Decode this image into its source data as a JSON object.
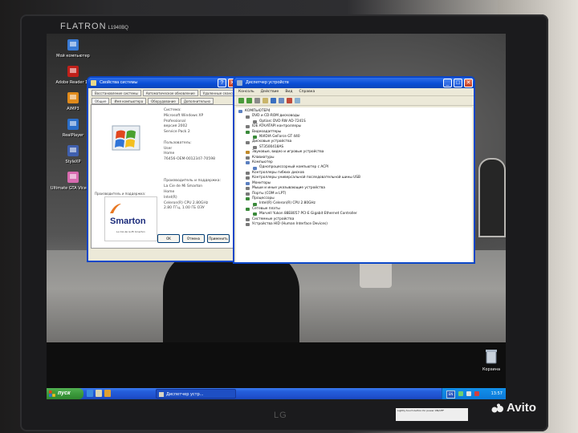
{
  "monitor": {
    "brand": "FLATRON",
    "model": "L1940BQ",
    "maker": "LG",
    "sticker": "Lightly touch button for power ON/OFF"
  },
  "watermark": "Avito",
  "desktop_icons": [
    {
      "label": "Мой компьютер",
      "icon": "computer-icon",
      "color": "#3a7bd5"
    },
    {
      "label": "Adobe Reader 10",
      "icon": "adobe-reader-icon",
      "color": "#c0201a"
    },
    {
      "label": "AIMP3",
      "icon": "aimp-icon",
      "color": "#e08a1a"
    },
    {
      "label": "RealPlayer",
      "icon": "realplayer-icon",
      "color": "#2b6ec8"
    },
    {
      "label": "StyleXP",
      "icon": "stylexp-icon",
      "color": "#3f5fae"
    },
    {
      "label": "Ultimate GTA Vice City",
      "icon": "gta-icon",
      "color": "#d86bb0"
    }
  ],
  "recycle_bin": {
    "label": "Корзина",
    "icon": "recycle-bin-icon"
  },
  "system_properties": {
    "title": "Свойства системы",
    "tabs_top": [
      "Восстановление системы",
      "Автоматическое обновление",
      "Удаленные сеансы"
    ],
    "tabs_bottom": [
      "Общие",
      "Имя компьютера",
      "Оборудование",
      "Дополнительно"
    ],
    "lines": [
      "Система:",
      "Microsoft Windows XP",
      "Professional",
      "версия 2002",
      "Service Pack 2",
      "",
      "Пользователь:",
      "User",
      "Home",
      "76456-OEM-0012347-70598",
      "",
      "",
      "",
      "Производитель и поддержка:",
      "La Cie de Mi Smarton",
      "Home",
      "Intel(R)",
      "Celeron(R) CPU 2.80GHz",
      "2.80 ГГц, 1.00 ГБ ОЗУ"
    ],
    "manufacturer_label": "Производитель и поддержка:",
    "logo_text": "Smarton",
    "logo_tagline": "La Cie de la Mi Smarton",
    "buttons": [
      "OK",
      "Отмена",
      "Применить"
    ]
  },
  "device_manager": {
    "title": "Диспетчер устройств",
    "menu": [
      "Консоль",
      "Действие",
      "Вид",
      "Справка"
    ],
    "tree": [
      {
        "label": "КОМПЬЮТЕР4",
        "level": 0,
        "color": "#5a7fc0"
      },
      {
        "label": "DVD и CD-ROM дисководы",
        "level": 1,
        "color": "#7a7a7a"
      },
      {
        "label": "Optiarc DVD RW AD-7241S",
        "level": 2,
        "color": "#7a7a7a"
      },
      {
        "label": "IDE ATA/ATAPI контроллеры",
        "level": 1,
        "color": "#7a7a7a"
      },
      {
        "label": "Видеоадаптеры",
        "level": 1,
        "color": "#3a8a3a"
      },
      {
        "label": "NVIDIA GeForce GT 440",
        "level": 2,
        "color": "#3a8a3a"
      },
      {
        "label": "Дисковые устройства",
        "level": 1,
        "color": "#7a7a7a"
      },
      {
        "label": "ST3500418AS",
        "level": 2,
        "color": "#7a7a7a"
      },
      {
        "label": "Звуковые, видео и игровые устройства",
        "level": 1,
        "color": "#c08a2a"
      },
      {
        "label": "Клавиатуры",
        "level": 1,
        "color": "#7a7a7a"
      },
      {
        "label": "Компьютер",
        "level": 1,
        "color": "#5a7fc0"
      },
      {
        "label": "Однопроцессорный компьютер с ACPI",
        "level": 2,
        "color": "#5a7fc0"
      },
      {
        "label": "Контроллеры гибких дисков",
        "level": 1,
        "color": "#7a7a7a"
      },
      {
        "label": "Контроллеры универсальной последовательной шины USB",
        "level": 1,
        "color": "#7a7a7a"
      },
      {
        "label": "Мониторы",
        "level": 1,
        "color": "#5a7fc0"
      },
      {
        "label": "Мыши и иные указывающие устройства",
        "level": 1,
        "color": "#7a7a7a"
      },
      {
        "label": "Порты (COM и LPT)",
        "level": 1,
        "color": "#7a7a7a"
      },
      {
        "label": "Процессоры",
        "level": 1,
        "color": "#3a8a3a"
      },
      {
        "label": "Intel(R) Celeron(R) CPU 2.80GHz",
        "level": 2,
        "color": "#3a8a3a"
      },
      {
        "label": "Сетевые платы",
        "level": 1,
        "color": "#3a8a3a"
      },
      {
        "label": "Marvell Yukon 88E8057 PCI-E Gigabit Ethernet Controller",
        "level": 2,
        "color": "#3a8a3a"
      },
      {
        "label": "Системные устройства",
        "level": 1,
        "color": "#7a7a7a"
      },
      {
        "label": "Устройства HID (Human Interface Devices)",
        "level": 1,
        "color": "#7a7a7a"
      }
    ]
  },
  "taskbar": {
    "start_label": "пуск",
    "task": "Диспетчер устр...",
    "lang": "EN",
    "clock": "13:57"
  }
}
